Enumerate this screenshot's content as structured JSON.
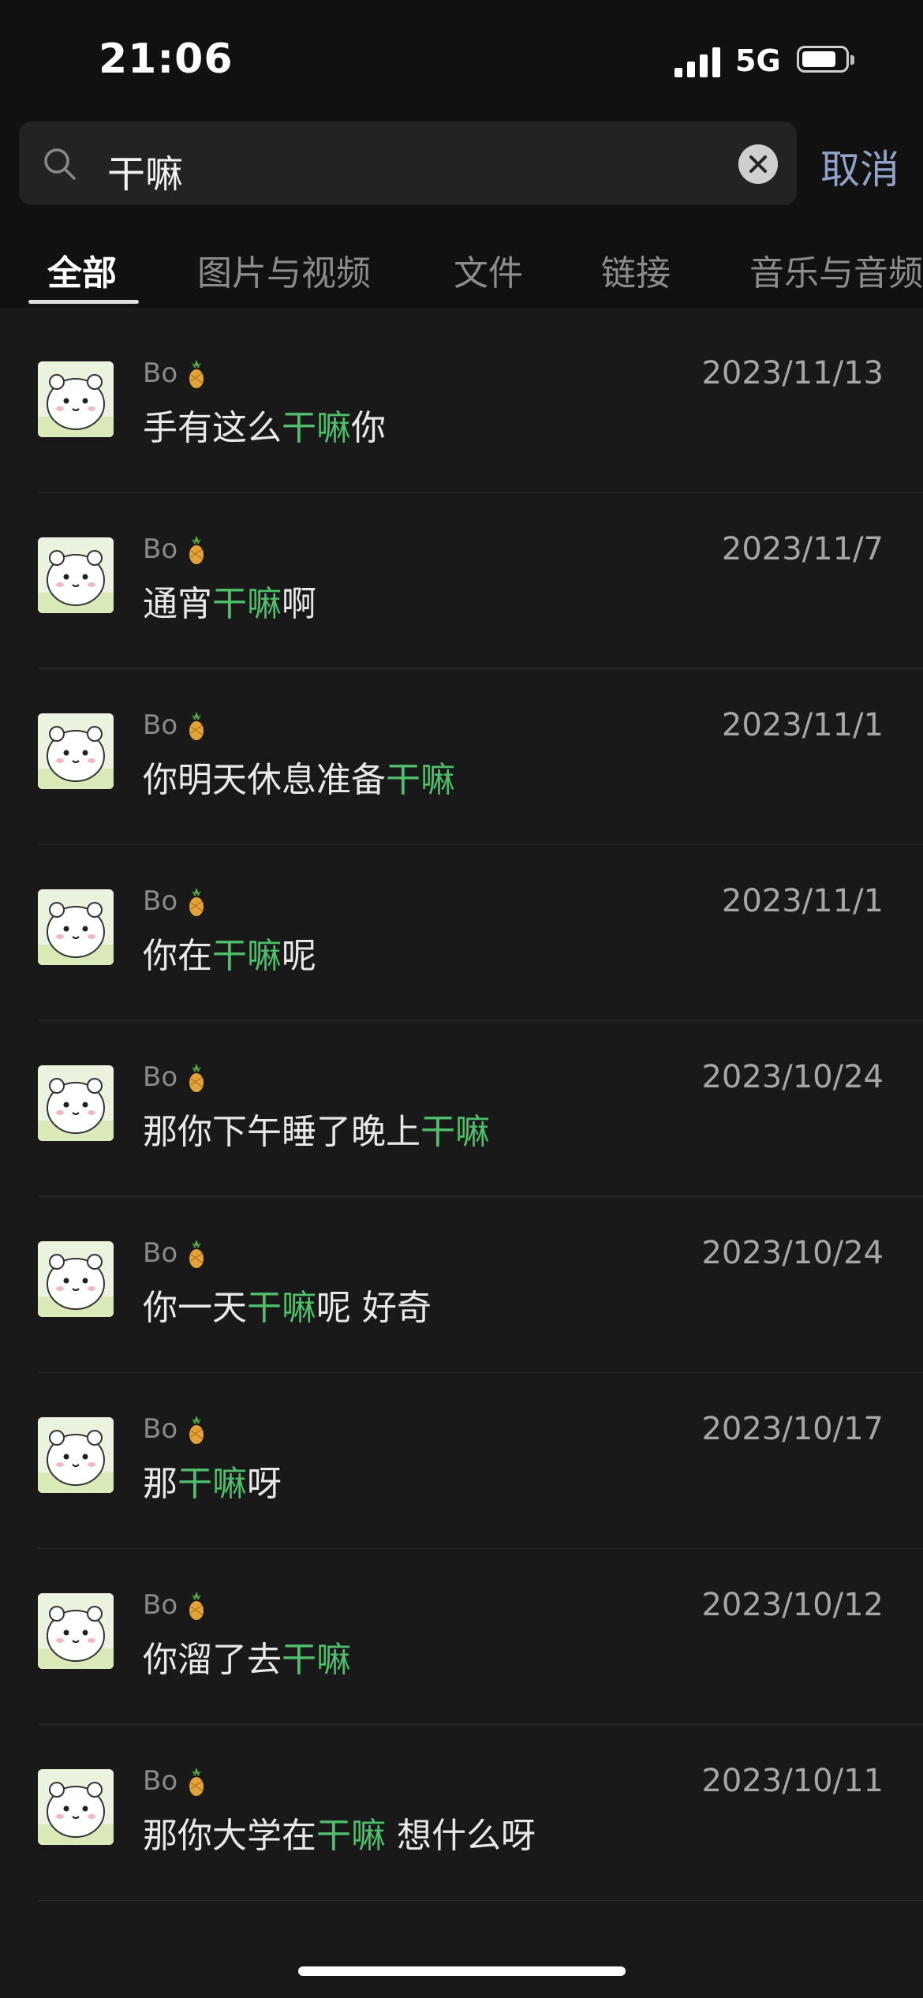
{
  "status": {
    "time": "21:06",
    "network": "5G"
  },
  "search": {
    "query": "干嘛",
    "cancel_label": "取消"
  },
  "tabs": [
    "全部",
    "图片与视频",
    "文件",
    "链接",
    "音乐与音频"
  ],
  "results": [
    {
      "sender": "Bo",
      "date": "2023/11/13",
      "pre": "手有这么",
      "hit": "干嘛",
      "post": "你"
    },
    {
      "sender": "Bo",
      "date": "2023/11/7",
      "pre": "通宵",
      "hit": "干嘛",
      "post": "啊"
    },
    {
      "sender": "Bo",
      "date": "2023/11/1",
      "pre": "你明天休息准备",
      "hit": "干嘛",
      "post": ""
    },
    {
      "sender": "Bo",
      "date": "2023/11/1",
      "pre": "你在",
      "hit": "干嘛",
      "post": "呢"
    },
    {
      "sender": "Bo",
      "date": "2023/10/24",
      "pre": "那你下午睡了晚上",
      "hit": "干嘛",
      "post": ""
    },
    {
      "sender": "Bo",
      "date": "2023/10/24",
      "pre": "你一天",
      "hit": "干嘛",
      "post": "呢 好奇"
    },
    {
      "sender": "Bo",
      "date": "2023/10/17",
      "pre": "那",
      "hit": "干嘛",
      "post": "呀"
    },
    {
      "sender": "Bo",
      "date": "2023/10/12",
      "pre": "你溜了去",
      "hit": "干嘛",
      "post": ""
    },
    {
      "sender": "Bo",
      "date": "2023/10/11",
      "pre": "那你大学在",
      "hit": "干嘛",
      "post": " 想什么呀"
    }
  ],
  "colors": {
    "highlight": "#4fbf6b",
    "cancel": "#8fa3c9",
    "background": "#191919"
  }
}
